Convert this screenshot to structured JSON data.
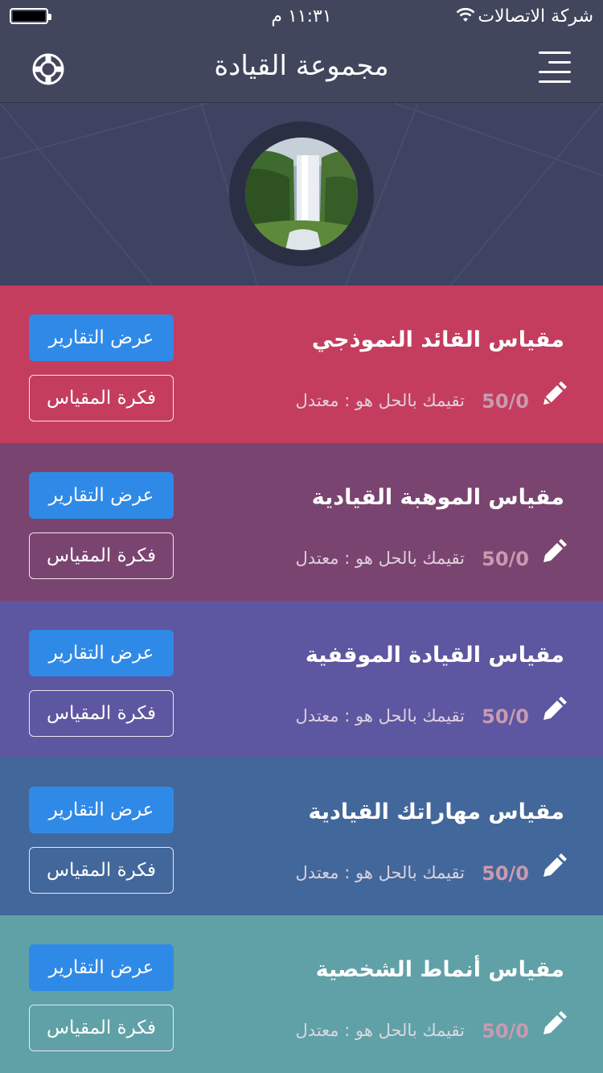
{
  "status_bar": {
    "carrier": "شركة الاتصالات",
    "time": "١١:٣١ م",
    "wifi_icon": "wifi-icon",
    "battery_icon": "battery-icon"
  },
  "nav": {
    "title": "مجموعة القيادة",
    "menu_icon": "hamburger-menu-icon",
    "help_icon": "lifebuoy-icon"
  },
  "hero": {
    "avatar_icon": "waterfall-avatar"
  },
  "cards": [
    {
      "title": "مقياس القائد النموذجي",
      "score": "50/0",
      "result": "تقيمك بالحل هو : معتدل",
      "reports_label": "عرض التقارير",
      "idea_label": "فكرة المقياس",
      "color": "#c43d5f"
    },
    {
      "title": "مقياس الموهبة القيادية",
      "score": "50/0",
      "result": "تقيمك بالحل هو : معتدل",
      "reports_label": "عرض التقارير",
      "idea_label": "فكرة المقياس",
      "color": "#7a4470"
    },
    {
      "title": "مقياس القيادة الموقفية",
      "score": "50/0",
      "result": "تقيمك بالحل هو : معتدل",
      "reports_label": "عرض التقارير",
      "idea_label": "فكرة المقياس",
      "color": "#5d56a0"
    },
    {
      "title": "مقياس مهاراتك القيادية",
      "score": "50/0",
      "result": "تقيمك بالحل هو : معتدل",
      "reports_label": "عرض التقارير",
      "idea_label": "فكرة المقياس",
      "color": "#42679a"
    },
    {
      "title": "مقياس أنماط الشخصية",
      "score": "50/0",
      "result": "تقيمك بالحل هو : معتدل",
      "reports_label": "عرض التقارير",
      "idea_label": "فكرة المقياس",
      "color": "#5fa1a7"
    }
  ],
  "colors": {
    "nav_bg": "#42465c",
    "hero_bg": "#3d4360",
    "button_blue": "#2f8ae7"
  }
}
